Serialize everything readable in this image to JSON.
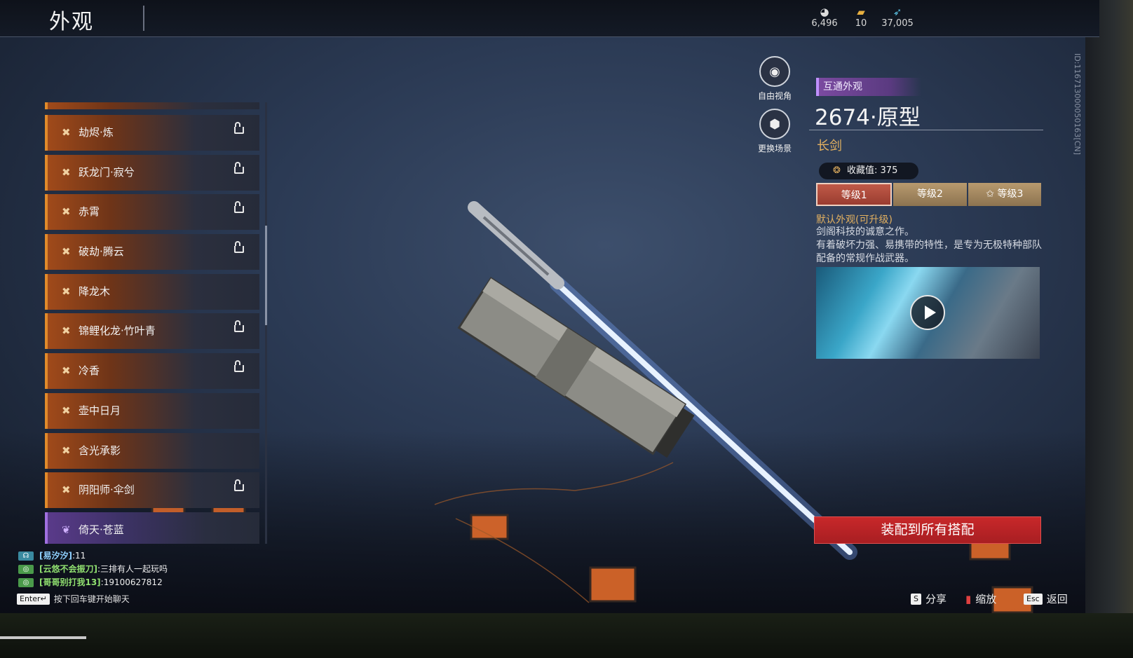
{
  "header": {
    "title": "外观"
  },
  "currencies": [
    {
      "icon": "eye-token-icon",
      "value": "6,496"
    },
    {
      "icon": "ticket-icon",
      "value": "10"
    },
    {
      "icon": "feather-icon",
      "value": "37,005"
    }
  ],
  "id_text": "ID:116713000050163[CN]",
  "list": {
    "items": [
      {
        "label": "劫烬·炼",
        "locked": true,
        "rarity": "orange"
      },
      {
        "label": "跃龙门·寂兮",
        "locked": true,
        "rarity": "orange"
      },
      {
        "label": "赤霄",
        "locked": true,
        "rarity": "orange"
      },
      {
        "label": "破劫·腾云",
        "locked": true,
        "rarity": "orange"
      },
      {
        "label": "降龙木",
        "locked": false,
        "rarity": "orange"
      },
      {
        "label": "锦鲤化龙·竹叶青",
        "locked": true,
        "rarity": "orange"
      },
      {
        "label": "冷香",
        "locked": true,
        "rarity": "orange"
      },
      {
        "label": "壶中日月",
        "locked": false,
        "rarity": "orange"
      },
      {
        "label": "含光承影",
        "locked": false,
        "rarity": "orange"
      },
      {
        "label": "阴阳师·伞剑",
        "locked": true,
        "rarity": "orange"
      },
      {
        "label": "倚天·苍蓝",
        "locked": false,
        "rarity": "purple"
      }
    ]
  },
  "side_buttons": {
    "free_view": "自由视角",
    "change_scene": "更换场景"
  },
  "detail": {
    "tag": "互通外观",
    "name": "2674·原型",
    "type": "长剑",
    "collect_label": "收藏值:",
    "collect_value": "375",
    "tiers": [
      "等级1",
      "等级2",
      "等级3"
    ],
    "active_tier": 0,
    "desc_title": "默认外观(可升级)",
    "desc_lines": [
      "剑阁科技的诚意之作。",
      "有着破坏力强、易携带的特性，是专为无极特种部队配备的常规作战武器。"
    ],
    "equip_button": "装配到所有搭配"
  },
  "chat": {
    "messages": [
      {
        "channel": "team",
        "name": "[易汐汐]",
        "text": ":11"
      },
      {
        "channel": "world",
        "name": "[云悠不会振刀]",
        "text": ":三排有人一起玩吗"
      },
      {
        "channel": "world",
        "name": "[哥哥别打我13]",
        "text": ":19100627812"
      }
    ],
    "hint_key": "Enter↵",
    "hint_text": "按下回车键开始聊天"
  },
  "shortcuts": {
    "share_key": "S",
    "share_label": "分享",
    "zoom_label": "缩放",
    "back_key": "Esc",
    "back_label": "返回"
  },
  "colors": {
    "accent_orange": "#e08a2a",
    "accent_purple": "#a070e0",
    "equip_red": "#c8282a",
    "gold_text": "#e2b060"
  }
}
